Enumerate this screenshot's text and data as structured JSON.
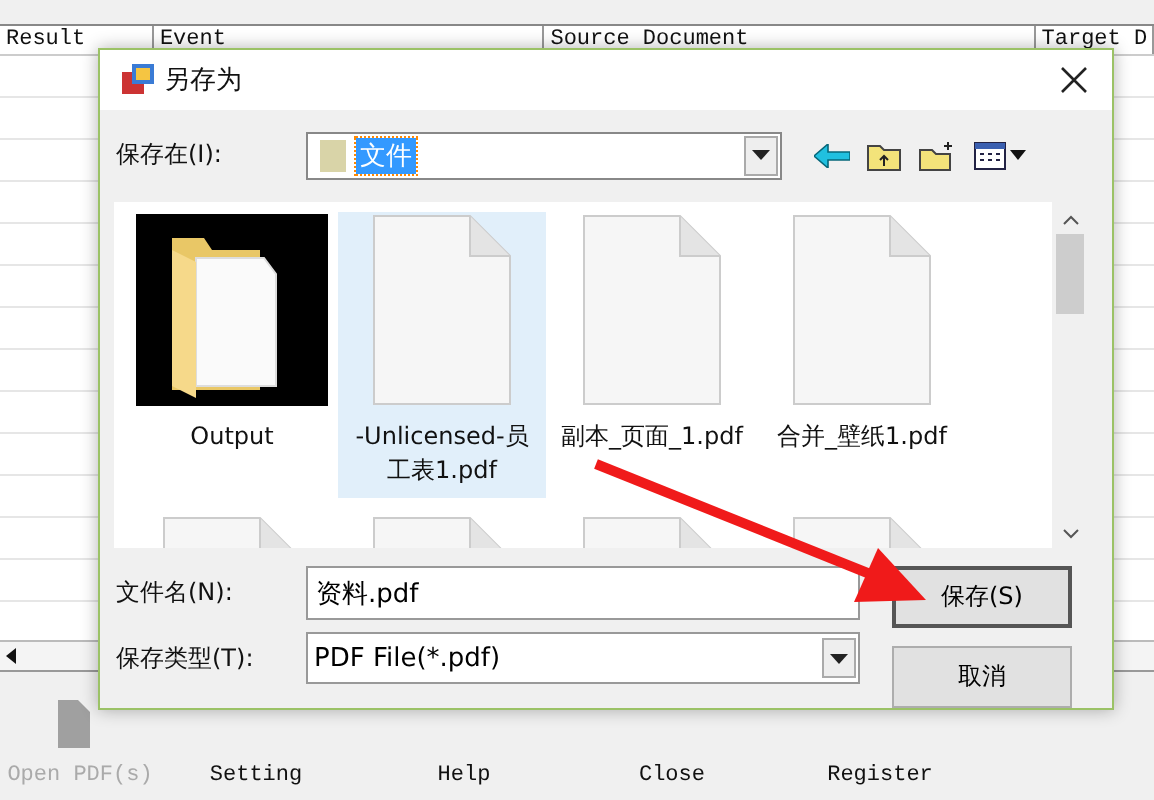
{
  "background_window": {
    "table": {
      "columns": [
        "Result",
        "Event",
        "Source Document",
        "Target D"
      ]
    },
    "toolbar": [
      {
        "label": "Open PDF(s)",
        "disabled": true
      },
      {
        "label": "Setting",
        "disabled": false
      },
      {
        "label": "Help",
        "disabled": false
      },
      {
        "label": "Close",
        "disabled": false
      },
      {
        "label": "Register",
        "disabled": false
      }
    ]
  },
  "dialog": {
    "title": "另存为",
    "save_in": {
      "label": "保存在(I):",
      "value": "文件"
    },
    "files": [
      {
        "name": "Output",
        "kind": "folder",
        "selected": false
      },
      {
        "name": "-Unlicensed-员工表1.pdf",
        "kind": "file",
        "selected": true
      },
      {
        "name": "副本_页面_1.pdf",
        "kind": "file",
        "selected": false
      },
      {
        "name": "合并_壁纸1.pdf",
        "kind": "file",
        "selected": false
      },
      {
        "kind": "file",
        "selected": false
      },
      {
        "kind": "file",
        "selected": false
      },
      {
        "kind": "file",
        "selected": false
      },
      {
        "kind": "file",
        "selected": false
      }
    ],
    "file_name": {
      "label": "文件名(N):",
      "value": "资料.pdf"
    },
    "file_type": {
      "label": "保存类型(T):",
      "value": "PDF File(*.pdf)"
    },
    "buttons": [
      "保存(S)",
      "取消"
    ]
  }
}
